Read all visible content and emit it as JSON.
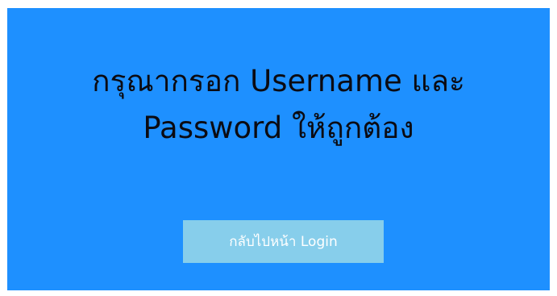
{
  "alert": {
    "message_line_1": "กรุณากรอก Username และ",
    "message_line_2": "Password ให้ถูกต้อง"
  },
  "actions": {
    "back_to_login_label": "กลับไปหน้า Login"
  },
  "colors": {
    "panel_background": "#1e90ff",
    "button_background": "#87ceeb",
    "message_text": "#0b0b12",
    "button_text": "#ffffff"
  }
}
